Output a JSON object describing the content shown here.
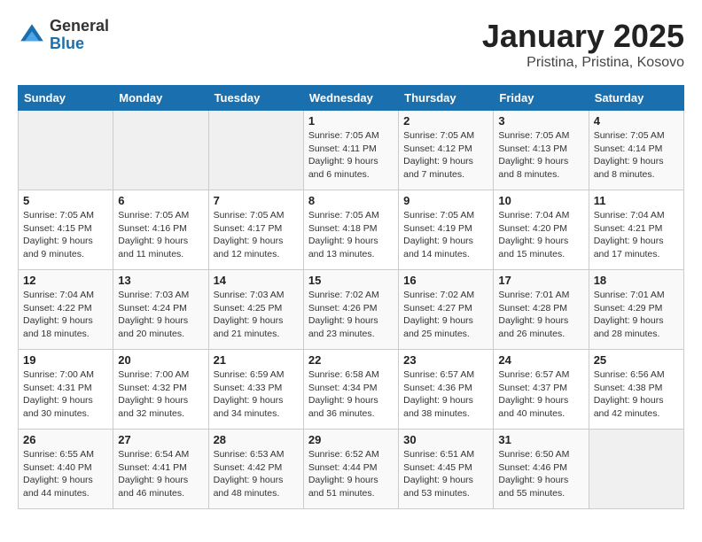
{
  "header": {
    "logo_general": "General",
    "logo_blue": "Blue",
    "title": "January 2025",
    "subtitle": "Pristina, Pristina, Kosovo"
  },
  "calendar": {
    "weekdays": [
      "Sunday",
      "Monday",
      "Tuesday",
      "Wednesday",
      "Thursday",
      "Friday",
      "Saturday"
    ],
    "weeks": [
      [
        {
          "day": "",
          "info": ""
        },
        {
          "day": "",
          "info": ""
        },
        {
          "day": "",
          "info": ""
        },
        {
          "day": "1",
          "info": "Sunrise: 7:05 AM\nSunset: 4:11 PM\nDaylight: 9 hours\nand 6 minutes."
        },
        {
          "day": "2",
          "info": "Sunrise: 7:05 AM\nSunset: 4:12 PM\nDaylight: 9 hours\nand 7 minutes."
        },
        {
          "day": "3",
          "info": "Sunrise: 7:05 AM\nSunset: 4:13 PM\nDaylight: 9 hours\nand 8 minutes."
        },
        {
          "day": "4",
          "info": "Sunrise: 7:05 AM\nSunset: 4:14 PM\nDaylight: 9 hours\nand 8 minutes."
        }
      ],
      [
        {
          "day": "5",
          "info": "Sunrise: 7:05 AM\nSunset: 4:15 PM\nDaylight: 9 hours\nand 9 minutes."
        },
        {
          "day": "6",
          "info": "Sunrise: 7:05 AM\nSunset: 4:16 PM\nDaylight: 9 hours\nand 11 minutes."
        },
        {
          "day": "7",
          "info": "Sunrise: 7:05 AM\nSunset: 4:17 PM\nDaylight: 9 hours\nand 12 minutes."
        },
        {
          "day": "8",
          "info": "Sunrise: 7:05 AM\nSunset: 4:18 PM\nDaylight: 9 hours\nand 13 minutes."
        },
        {
          "day": "9",
          "info": "Sunrise: 7:05 AM\nSunset: 4:19 PM\nDaylight: 9 hours\nand 14 minutes."
        },
        {
          "day": "10",
          "info": "Sunrise: 7:04 AM\nSunset: 4:20 PM\nDaylight: 9 hours\nand 15 minutes."
        },
        {
          "day": "11",
          "info": "Sunrise: 7:04 AM\nSunset: 4:21 PM\nDaylight: 9 hours\nand 17 minutes."
        }
      ],
      [
        {
          "day": "12",
          "info": "Sunrise: 7:04 AM\nSunset: 4:22 PM\nDaylight: 9 hours\nand 18 minutes."
        },
        {
          "day": "13",
          "info": "Sunrise: 7:03 AM\nSunset: 4:24 PM\nDaylight: 9 hours\nand 20 minutes."
        },
        {
          "day": "14",
          "info": "Sunrise: 7:03 AM\nSunset: 4:25 PM\nDaylight: 9 hours\nand 21 minutes."
        },
        {
          "day": "15",
          "info": "Sunrise: 7:02 AM\nSunset: 4:26 PM\nDaylight: 9 hours\nand 23 minutes."
        },
        {
          "day": "16",
          "info": "Sunrise: 7:02 AM\nSunset: 4:27 PM\nDaylight: 9 hours\nand 25 minutes."
        },
        {
          "day": "17",
          "info": "Sunrise: 7:01 AM\nSunset: 4:28 PM\nDaylight: 9 hours\nand 26 minutes."
        },
        {
          "day": "18",
          "info": "Sunrise: 7:01 AM\nSunset: 4:29 PM\nDaylight: 9 hours\nand 28 minutes."
        }
      ],
      [
        {
          "day": "19",
          "info": "Sunrise: 7:00 AM\nSunset: 4:31 PM\nDaylight: 9 hours\nand 30 minutes."
        },
        {
          "day": "20",
          "info": "Sunrise: 7:00 AM\nSunset: 4:32 PM\nDaylight: 9 hours\nand 32 minutes."
        },
        {
          "day": "21",
          "info": "Sunrise: 6:59 AM\nSunset: 4:33 PM\nDaylight: 9 hours\nand 34 minutes."
        },
        {
          "day": "22",
          "info": "Sunrise: 6:58 AM\nSunset: 4:34 PM\nDaylight: 9 hours\nand 36 minutes."
        },
        {
          "day": "23",
          "info": "Sunrise: 6:57 AM\nSunset: 4:36 PM\nDaylight: 9 hours\nand 38 minutes."
        },
        {
          "day": "24",
          "info": "Sunrise: 6:57 AM\nSunset: 4:37 PM\nDaylight: 9 hours\nand 40 minutes."
        },
        {
          "day": "25",
          "info": "Sunrise: 6:56 AM\nSunset: 4:38 PM\nDaylight: 9 hours\nand 42 minutes."
        }
      ],
      [
        {
          "day": "26",
          "info": "Sunrise: 6:55 AM\nSunset: 4:40 PM\nDaylight: 9 hours\nand 44 minutes."
        },
        {
          "day": "27",
          "info": "Sunrise: 6:54 AM\nSunset: 4:41 PM\nDaylight: 9 hours\nand 46 minutes."
        },
        {
          "day": "28",
          "info": "Sunrise: 6:53 AM\nSunset: 4:42 PM\nDaylight: 9 hours\nand 48 minutes."
        },
        {
          "day": "29",
          "info": "Sunrise: 6:52 AM\nSunset: 4:44 PM\nDaylight: 9 hours\nand 51 minutes."
        },
        {
          "day": "30",
          "info": "Sunrise: 6:51 AM\nSunset: 4:45 PM\nDaylight: 9 hours\nand 53 minutes."
        },
        {
          "day": "31",
          "info": "Sunrise: 6:50 AM\nSunset: 4:46 PM\nDaylight: 9 hours\nand 55 minutes."
        },
        {
          "day": "",
          "info": ""
        }
      ]
    ]
  }
}
